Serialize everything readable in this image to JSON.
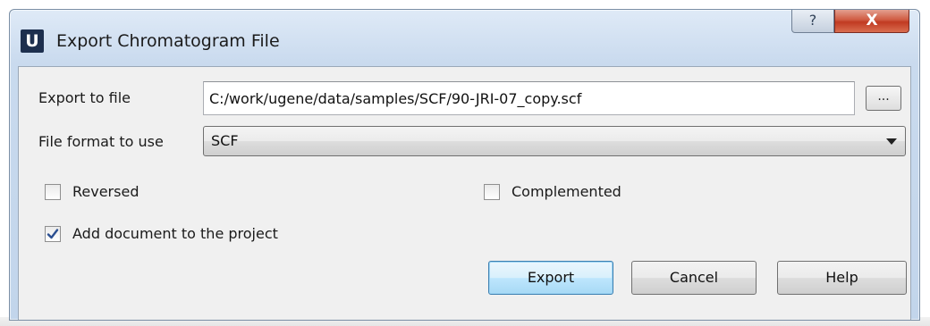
{
  "window": {
    "title": "Export Chromatogram File",
    "app_icon_letter": "U",
    "help_glyph": "?",
    "close_glyph": "X"
  },
  "form": {
    "export_label": "Export to file",
    "export_value": "C:/work/ugene/data/samples/SCF/90-JRI-07_copy.scf",
    "browse_label": "...",
    "format_label": "File format to use",
    "format_value": "SCF"
  },
  "options": {
    "reversed": {
      "label": "Reversed",
      "checked": false
    },
    "complemented": {
      "label": "Complemented",
      "checked": false
    },
    "add_to_project": {
      "label": "Add document to the project",
      "checked": true
    }
  },
  "buttons": {
    "export": "Export",
    "cancel": "Cancel",
    "help": "Help"
  }
}
